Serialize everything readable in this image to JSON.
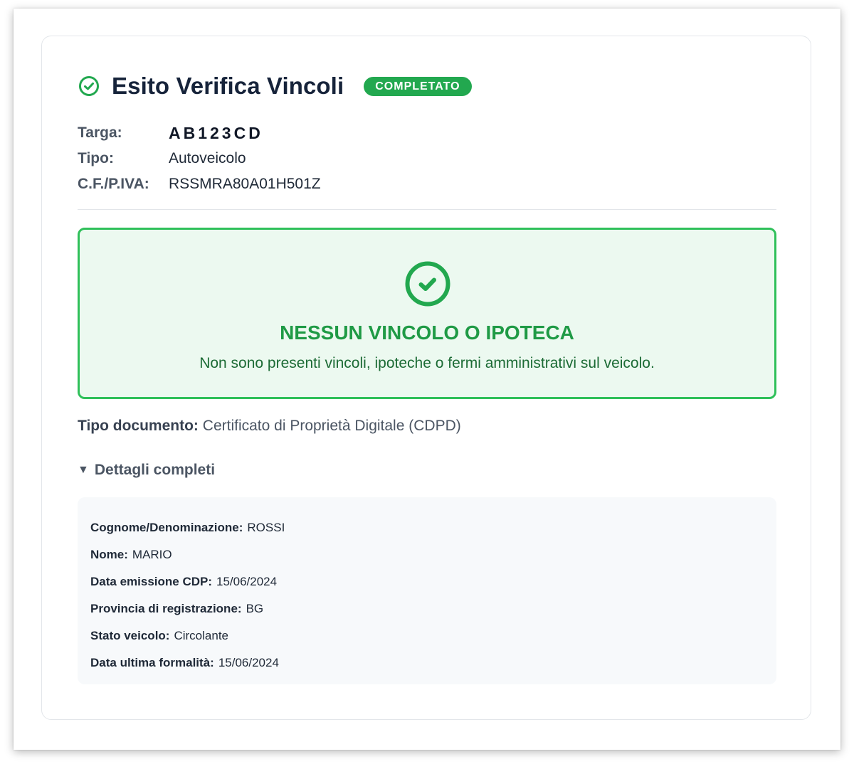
{
  "header": {
    "title": "Esito Verifica Vincoli",
    "status_badge": "COMPLETATO",
    "accent_color": "#22a84f"
  },
  "vehicle": {
    "rows": [
      {
        "label": "Targa:",
        "value": "AB123CD"
      },
      {
        "label": "Tipo:",
        "value": "Autoveicolo"
      },
      {
        "label": "C.F./P.IVA:",
        "value": "RSSMRA80A01H501Z"
      }
    ]
  },
  "result": {
    "icon": "check-circle-icon",
    "title": "NESSUN VINCOLO O IPOTECA",
    "message": "Non sono presenti vincoli, ipoteche o fermi amministrativi sul veicolo.",
    "border_color": "#2fc05a",
    "background_color": "#ecf9f0"
  },
  "document": {
    "label": "Tipo documento:",
    "value": "Certificato di Proprietà Digitale (CDPD)"
  },
  "details": {
    "toggle_label": "Dettagli completi",
    "expanded": true,
    "rows": [
      {
        "label": "Cognome/Denominazione:",
        "value": "ROSSI"
      },
      {
        "label": "Nome:",
        "value": "MARIO"
      },
      {
        "label": "Data emissione CDP:",
        "value": "15/06/2024"
      },
      {
        "label": "Provincia di registrazione:",
        "value": "BG"
      },
      {
        "label": "Stato veicolo:",
        "value": "Circolante"
      },
      {
        "label": "Data ultima formalità:",
        "value": "15/06/2024"
      }
    ]
  }
}
